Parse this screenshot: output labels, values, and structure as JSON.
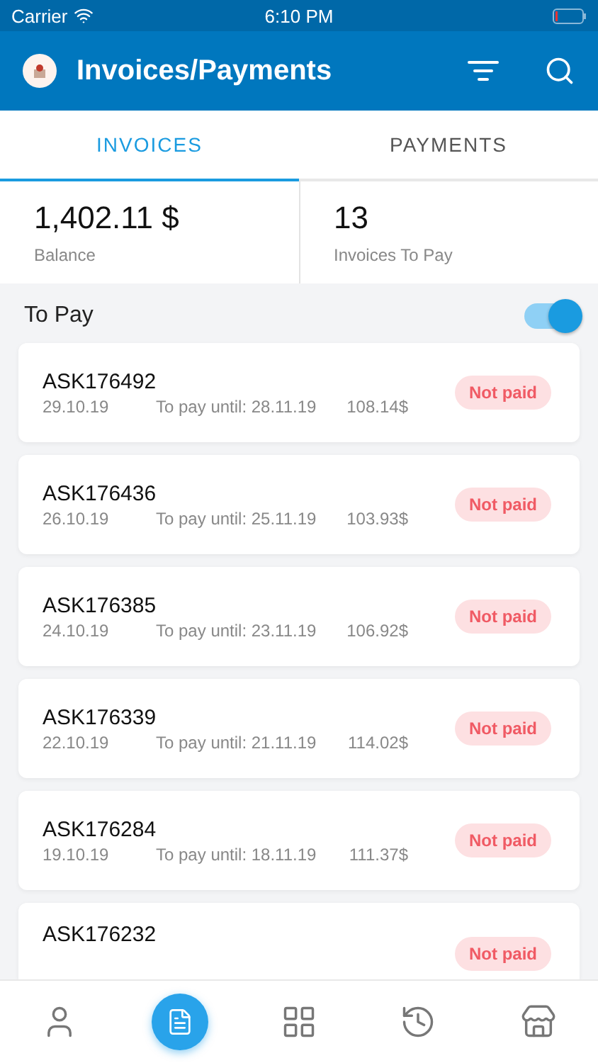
{
  "status_bar": {
    "carrier": "Carrier",
    "time": "6:10 PM"
  },
  "header": {
    "title": "Invoices/Payments"
  },
  "tabs": [
    {
      "label": "INVOICES",
      "selected": true
    },
    {
      "label": "PAYMENTS",
      "selected": false
    }
  ],
  "summary": [
    {
      "value": "1,402.11 $",
      "label": "Balance"
    },
    {
      "value": "13",
      "label": "Invoices To Pay"
    }
  ],
  "filter": {
    "label": "To Pay",
    "on": true
  },
  "invoices": [
    {
      "number": "ASK176492",
      "date": "29.10.19",
      "due": "To pay until: 28.11.19",
      "amount": "108.14$",
      "status": "Not paid"
    },
    {
      "number": "ASK176436",
      "date": "26.10.19",
      "due": "To pay until: 25.11.19",
      "amount": "103.93$",
      "status": "Not paid"
    },
    {
      "number": "ASK176385",
      "date": "24.10.19",
      "due": "To pay until: 23.11.19",
      "amount": "106.92$",
      "status": "Not paid"
    },
    {
      "number": "ASK176339",
      "date": "22.10.19",
      "due": "To pay until: 21.11.19",
      "amount": "114.02$",
      "status": "Not paid"
    },
    {
      "number": "ASK176284",
      "date": "19.10.19",
      "due": "To pay until: 18.11.19",
      "amount": "111.37$",
      "status": "Not paid"
    },
    {
      "number": "ASK176232",
      "status": "Not paid"
    }
  ],
  "nav": [
    {
      "kind": "profile",
      "selected": false
    },
    {
      "kind": "invoices",
      "selected": true
    },
    {
      "kind": "grid",
      "selected": false
    },
    {
      "kind": "history",
      "selected": false
    },
    {
      "kind": "store",
      "selected": false
    }
  ]
}
